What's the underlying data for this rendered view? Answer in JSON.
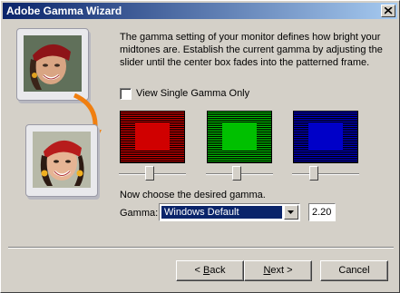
{
  "window": {
    "title": "Adobe Gamma Wizard"
  },
  "intro_text": "The gamma setting of your monitor defines how bright your midtones are. Establish the current gamma by adjusting the slider until the center box fades into the patterned frame.",
  "view_single": {
    "label": "View Single Gamma Only",
    "checked": false
  },
  "swatches": [
    {
      "name": "red",
      "color": "#d00000",
      "slider_value": 0.45
    },
    {
      "name": "green",
      "color": "#00c000",
      "slider_value": 0.45
    },
    {
      "name": "blue",
      "color": "#0000c8",
      "slider_value": 0.3
    }
  ],
  "choose_text": "Now choose the desired gamma.",
  "gamma": {
    "label": "Gamma:",
    "selected": "Windows Default",
    "value": "2.20"
  },
  "buttons": {
    "back": {
      "prefix": "< ",
      "accel": "B",
      "rest": "ack"
    },
    "next": {
      "accel": "N",
      "rest": "ext >"
    },
    "cancel": "Cancel"
  }
}
